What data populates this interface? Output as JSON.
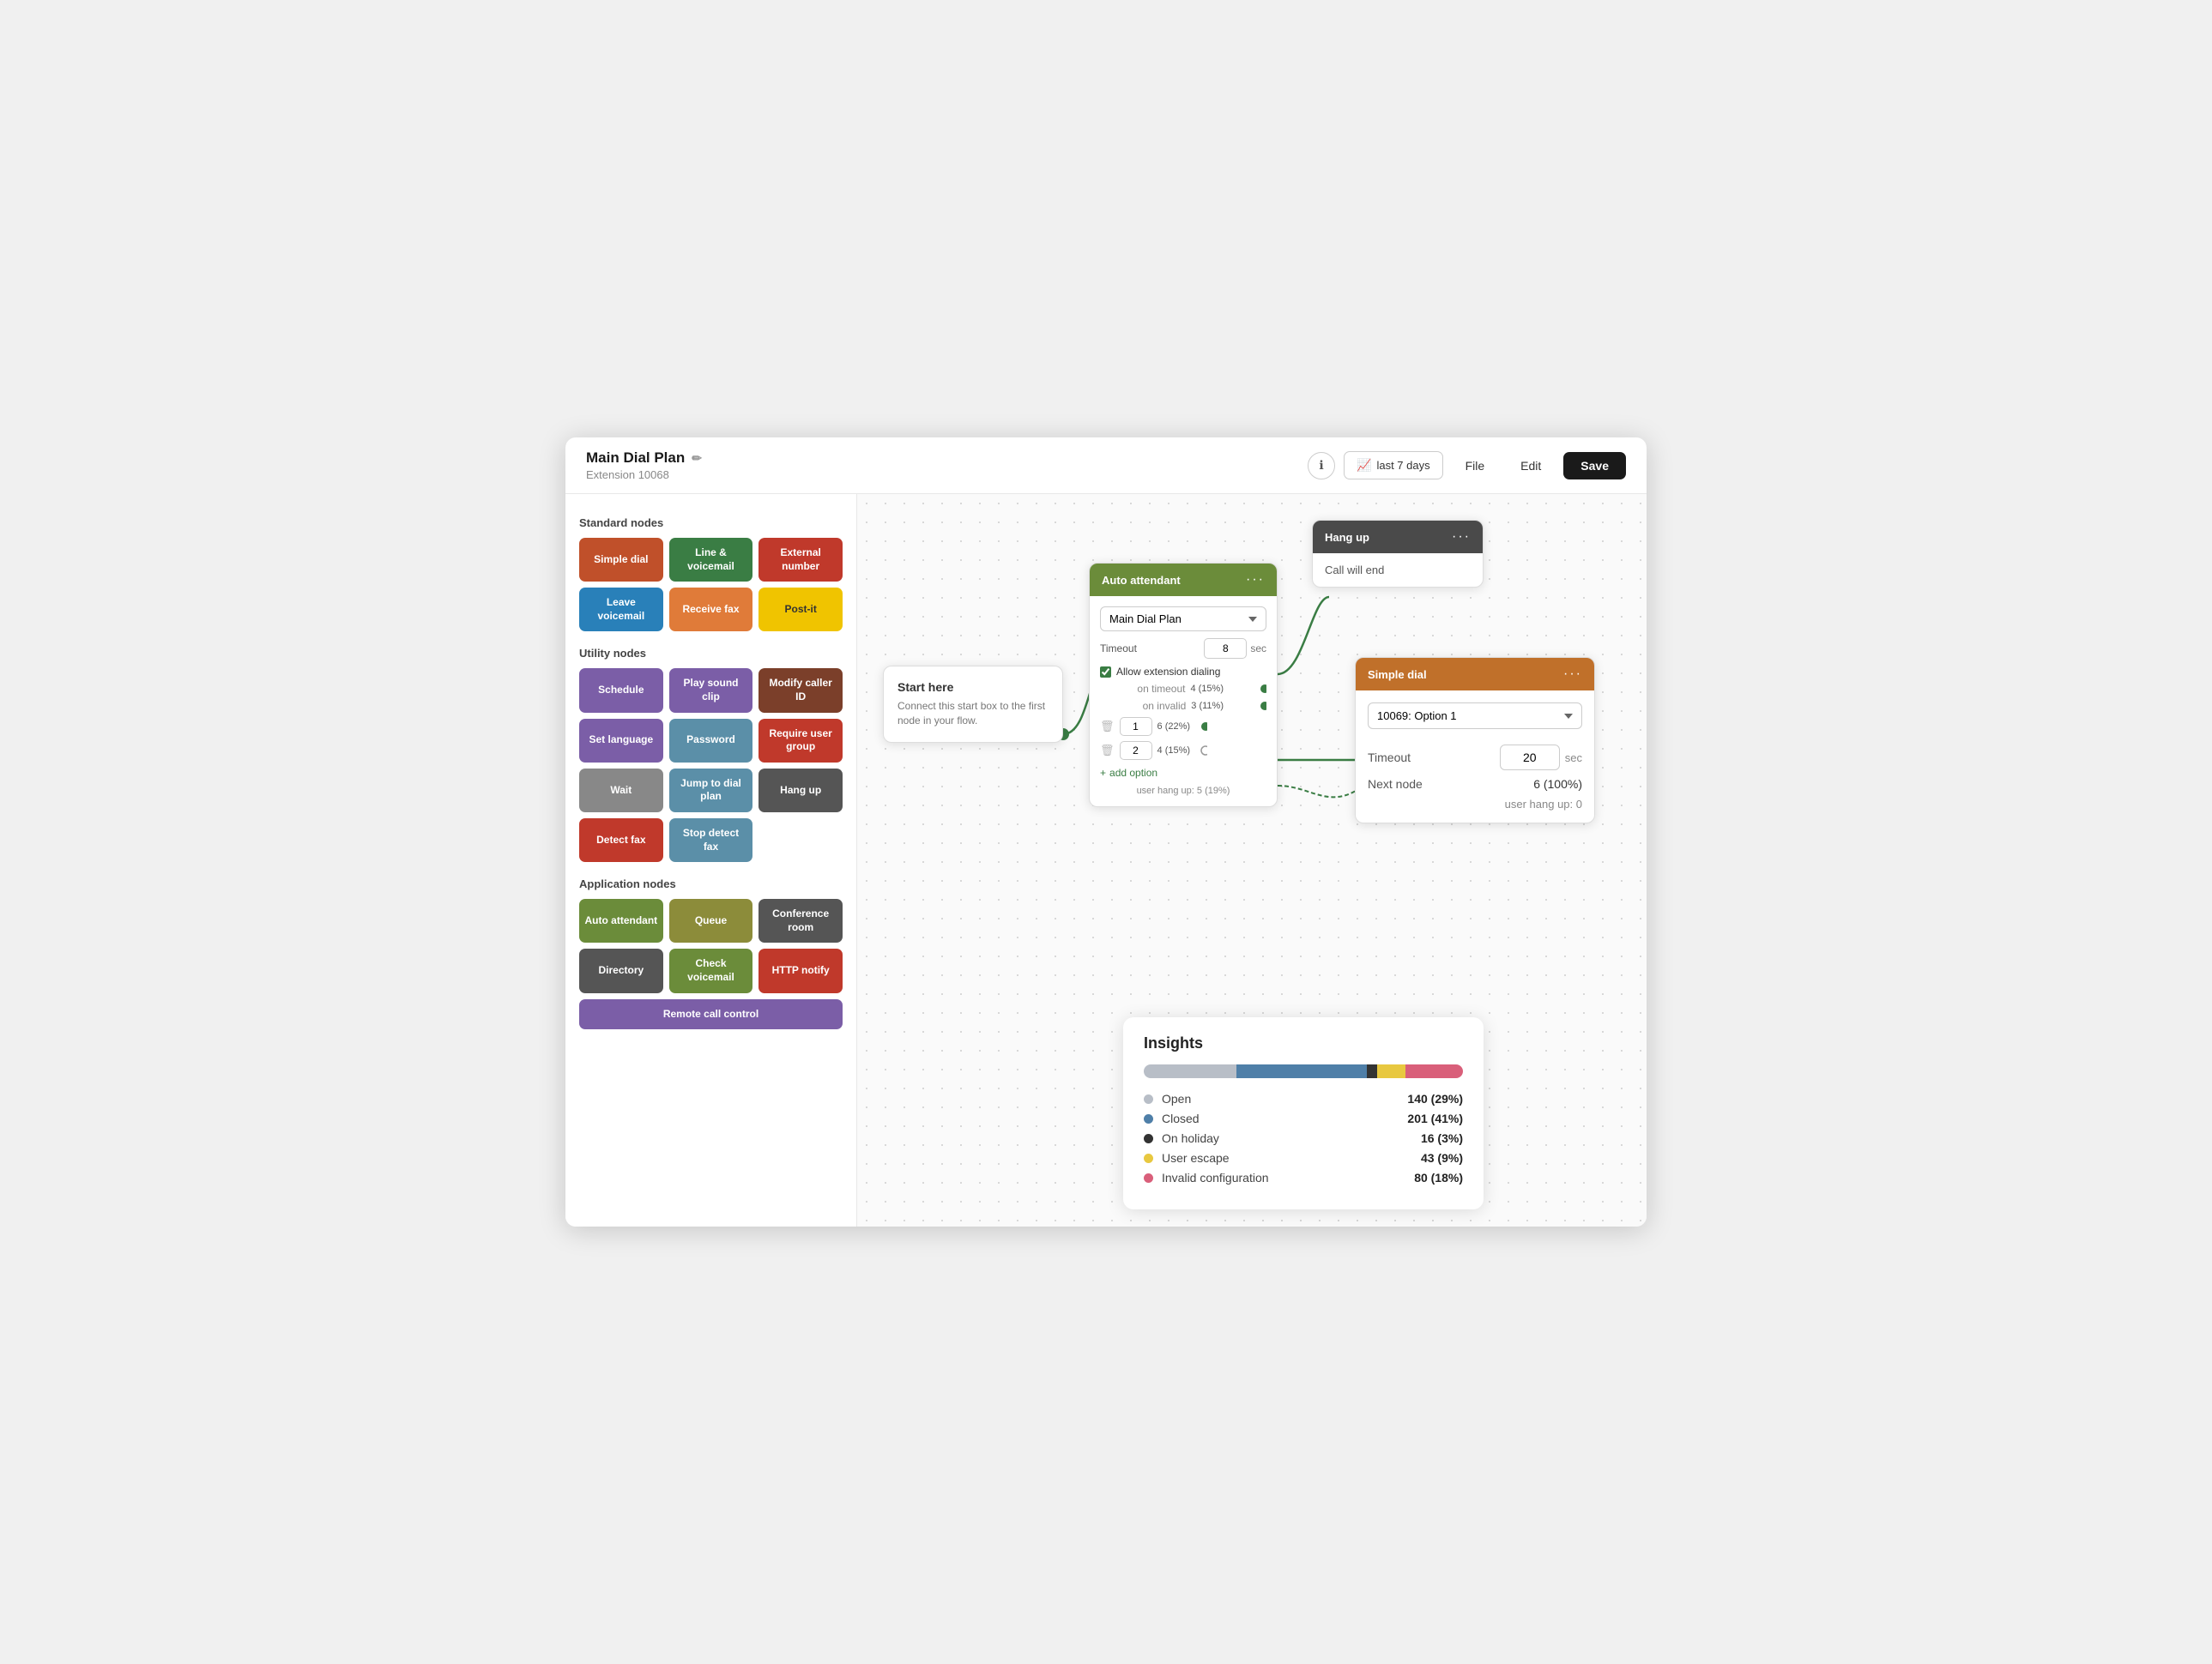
{
  "app": {
    "title": "Main Dial Plan",
    "subtitle": "Extension 10068",
    "edit_icon": "✏",
    "info_icon": "ℹ",
    "analytics_label": "last 7 days",
    "file_label": "File",
    "edit_label": "Edit",
    "save_label": "Save"
  },
  "sidebar": {
    "standard_title": "Standard nodes",
    "utility_title": "Utility nodes",
    "application_title": "Application nodes",
    "standard_nodes": [
      {
        "label": "Simple dial",
        "class": "n-simple-dial"
      },
      {
        "label": "Line & voicemail",
        "class": "n-line-voicemail"
      },
      {
        "label": "External number",
        "class": "n-external-number"
      },
      {
        "label": "Leave voicemail",
        "class": "n-leave-voicemail"
      },
      {
        "label": "Receive fax",
        "class": "n-receive-fax"
      },
      {
        "label": "Post-it",
        "class": "n-post-it"
      }
    ],
    "utility_nodes": [
      {
        "label": "Schedule",
        "class": "n-schedule"
      },
      {
        "label": "Play sound clip",
        "class": "n-play-sound"
      },
      {
        "label": "Modify caller ID",
        "class": "n-modify-caller"
      },
      {
        "label": "Set language",
        "class": "n-set-language"
      },
      {
        "label": "Password",
        "class": "n-password"
      },
      {
        "label": "Require user group",
        "class": "n-require-user"
      },
      {
        "label": "Wait",
        "class": "n-wait"
      },
      {
        "label": "Jump to dial plan",
        "class": "n-jump-dial"
      },
      {
        "label": "Hang up",
        "class": "n-hang-up-util"
      },
      {
        "label": "Detect fax",
        "class": "n-detect-fax"
      },
      {
        "label": "Stop detect fax",
        "class": "n-stop-detect"
      }
    ],
    "application_nodes": [
      {
        "label": "Auto attendant",
        "class": "n-auto-attendant"
      },
      {
        "label": "Queue",
        "class": "n-queue"
      },
      {
        "label": "Conference room",
        "class": "n-conference"
      },
      {
        "label": "Directory",
        "class": "n-directory"
      },
      {
        "label": "Check voicemail",
        "class": "n-check-voicemail"
      },
      {
        "label": "HTTP notify",
        "class": "n-http-notify"
      },
      {
        "label": "Remote call control",
        "class": "n-remote-call"
      }
    ]
  },
  "flow": {
    "start_node": {
      "title": "Start here",
      "desc": "Connect this start box to the first node in your flow."
    },
    "auto_attendant": {
      "header": "Auto attendant",
      "dropdown_value": "Main Dial Plan",
      "timeout_label": "Timeout",
      "timeout_value": "8",
      "timeout_unit": "sec",
      "allow_extension": "Allow extension dialing",
      "on_timeout_label": "on timeout",
      "on_timeout_stat": "4 (15%)",
      "on_invalid_label": "on invalid",
      "on_invalid_stat": "3 (11%)",
      "option1_value": "1",
      "option1_stat": "6 (22%)",
      "option2_value": "2",
      "option2_stat": "4 (15%)",
      "add_option_label": "+ add option",
      "user_hangup": "user hang up: 5 (19%)"
    },
    "hang_up": {
      "header": "Hang up",
      "call_will_end": "Call will end"
    },
    "simple_dial": {
      "header": "Simple dial",
      "dropdown_value": "10069: Option 1",
      "timeout_label": "Timeout",
      "timeout_value": "20",
      "timeout_unit": "sec",
      "next_node_label": "Next node",
      "next_node_value": "6 (100%)",
      "user_hangup": "user hang up: 0"
    }
  },
  "insights": {
    "title": "Insights",
    "bar": [
      {
        "color": "#b8bec7",
        "pct": 29
      },
      {
        "color": "#4f7fa8",
        "pct": 41
      },
      {
        "color": "#333",
        "pct": 3
      },
      {
        "color": "#e8c840",
        "pct": 9
      },
      {
        "color": "#d95f7a",
        "pct": 18
      }
    ],
    "rows": [
      {
        "label": "Open",
        "value": "140 (29%)",
        "color": "#b8bec7"
      },
      {
        "label": "Closed",
        "value": "201 (41%)",
        "color": "#4f7fa8"
      },
      {
        "label": "On holiday",
        "value": "16 (3%)",
        "color": "#333"
      },
      {
        "label": "User escape",
        "value": "43 (9%)",
        "color": "#e8c840"
      },
      {
        "label": "Invalid configuration",
        "value": "80 (18%)",
        "color": "#d95f7a"
      }
    ]
  }
}
